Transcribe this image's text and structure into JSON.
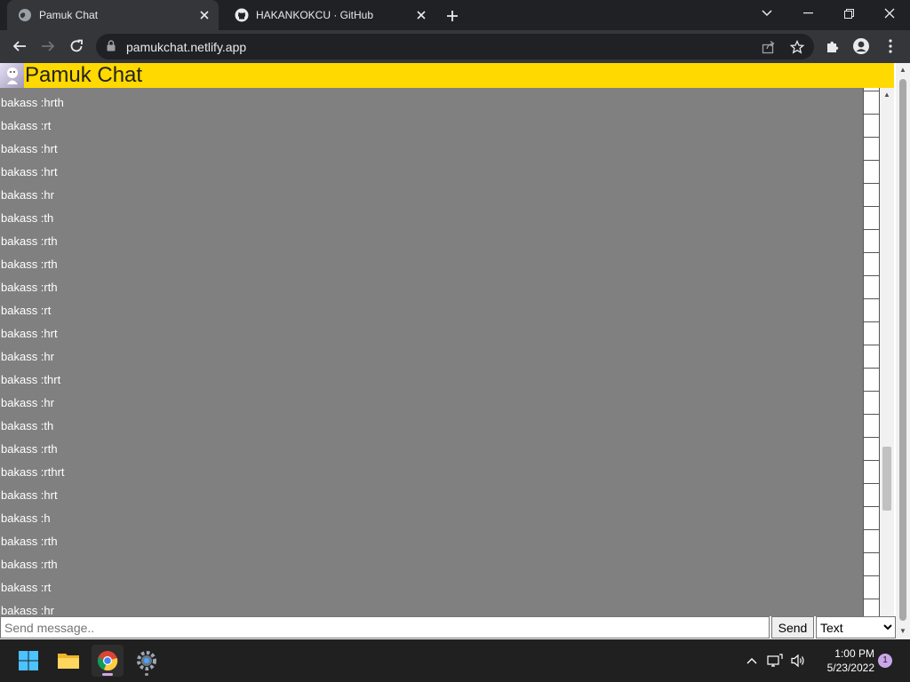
{
  "browser": {
    "tabs": [
      {
        "title": "Pamuk Chat",
        "active": true
      },
      {
        "title": "HAKANKOKCU · GitHub",
        "active": false
      }
    ],
    "url": "pamukchat.netlify.app"
  },
  "app": {
    "title": "Pamuk Chat",
    "messages": [
      "bakass :hr",
      "bakass :hrth",
      "bakass :rt",
      "bakass :hrt",
      "bakass :hrt",
      "bakass :hr",
      "bakass :th",
      "bakass :rth",
      "bakass :rth",
      "bakass :rth",
      "bakass :rt",
      "bakass :hrt",
      "bakass :hr",
      "bakass :thrt",
      "bakass :hr",
      "bakass :th",
      "bakass :rth",
      "bakass :rthrt",
      "bakass :hrt",
      "bakass :h",
      "bakass :rth",
      "bakass :rth",
      "bakass :rt",
      "bakass :hr"
    ],
    "composer": {
      "placeholder": "Send message..",
      "send_label": "Send",
      "type_selected": "Text"
    },
    "colors": {
      "header": "#ffd900",
      "messages_bg": "#808080"
    }
  },
  "taskbar": {
    "time": "1:00 PM",
    "date": "5/23/2022",
    "notification_count": "1",
    "icons": [
      "windows-start-icon",
      "file-explorer-icon",
      "chrome-icon",
      "settings-icon"
    ]
  }
}
